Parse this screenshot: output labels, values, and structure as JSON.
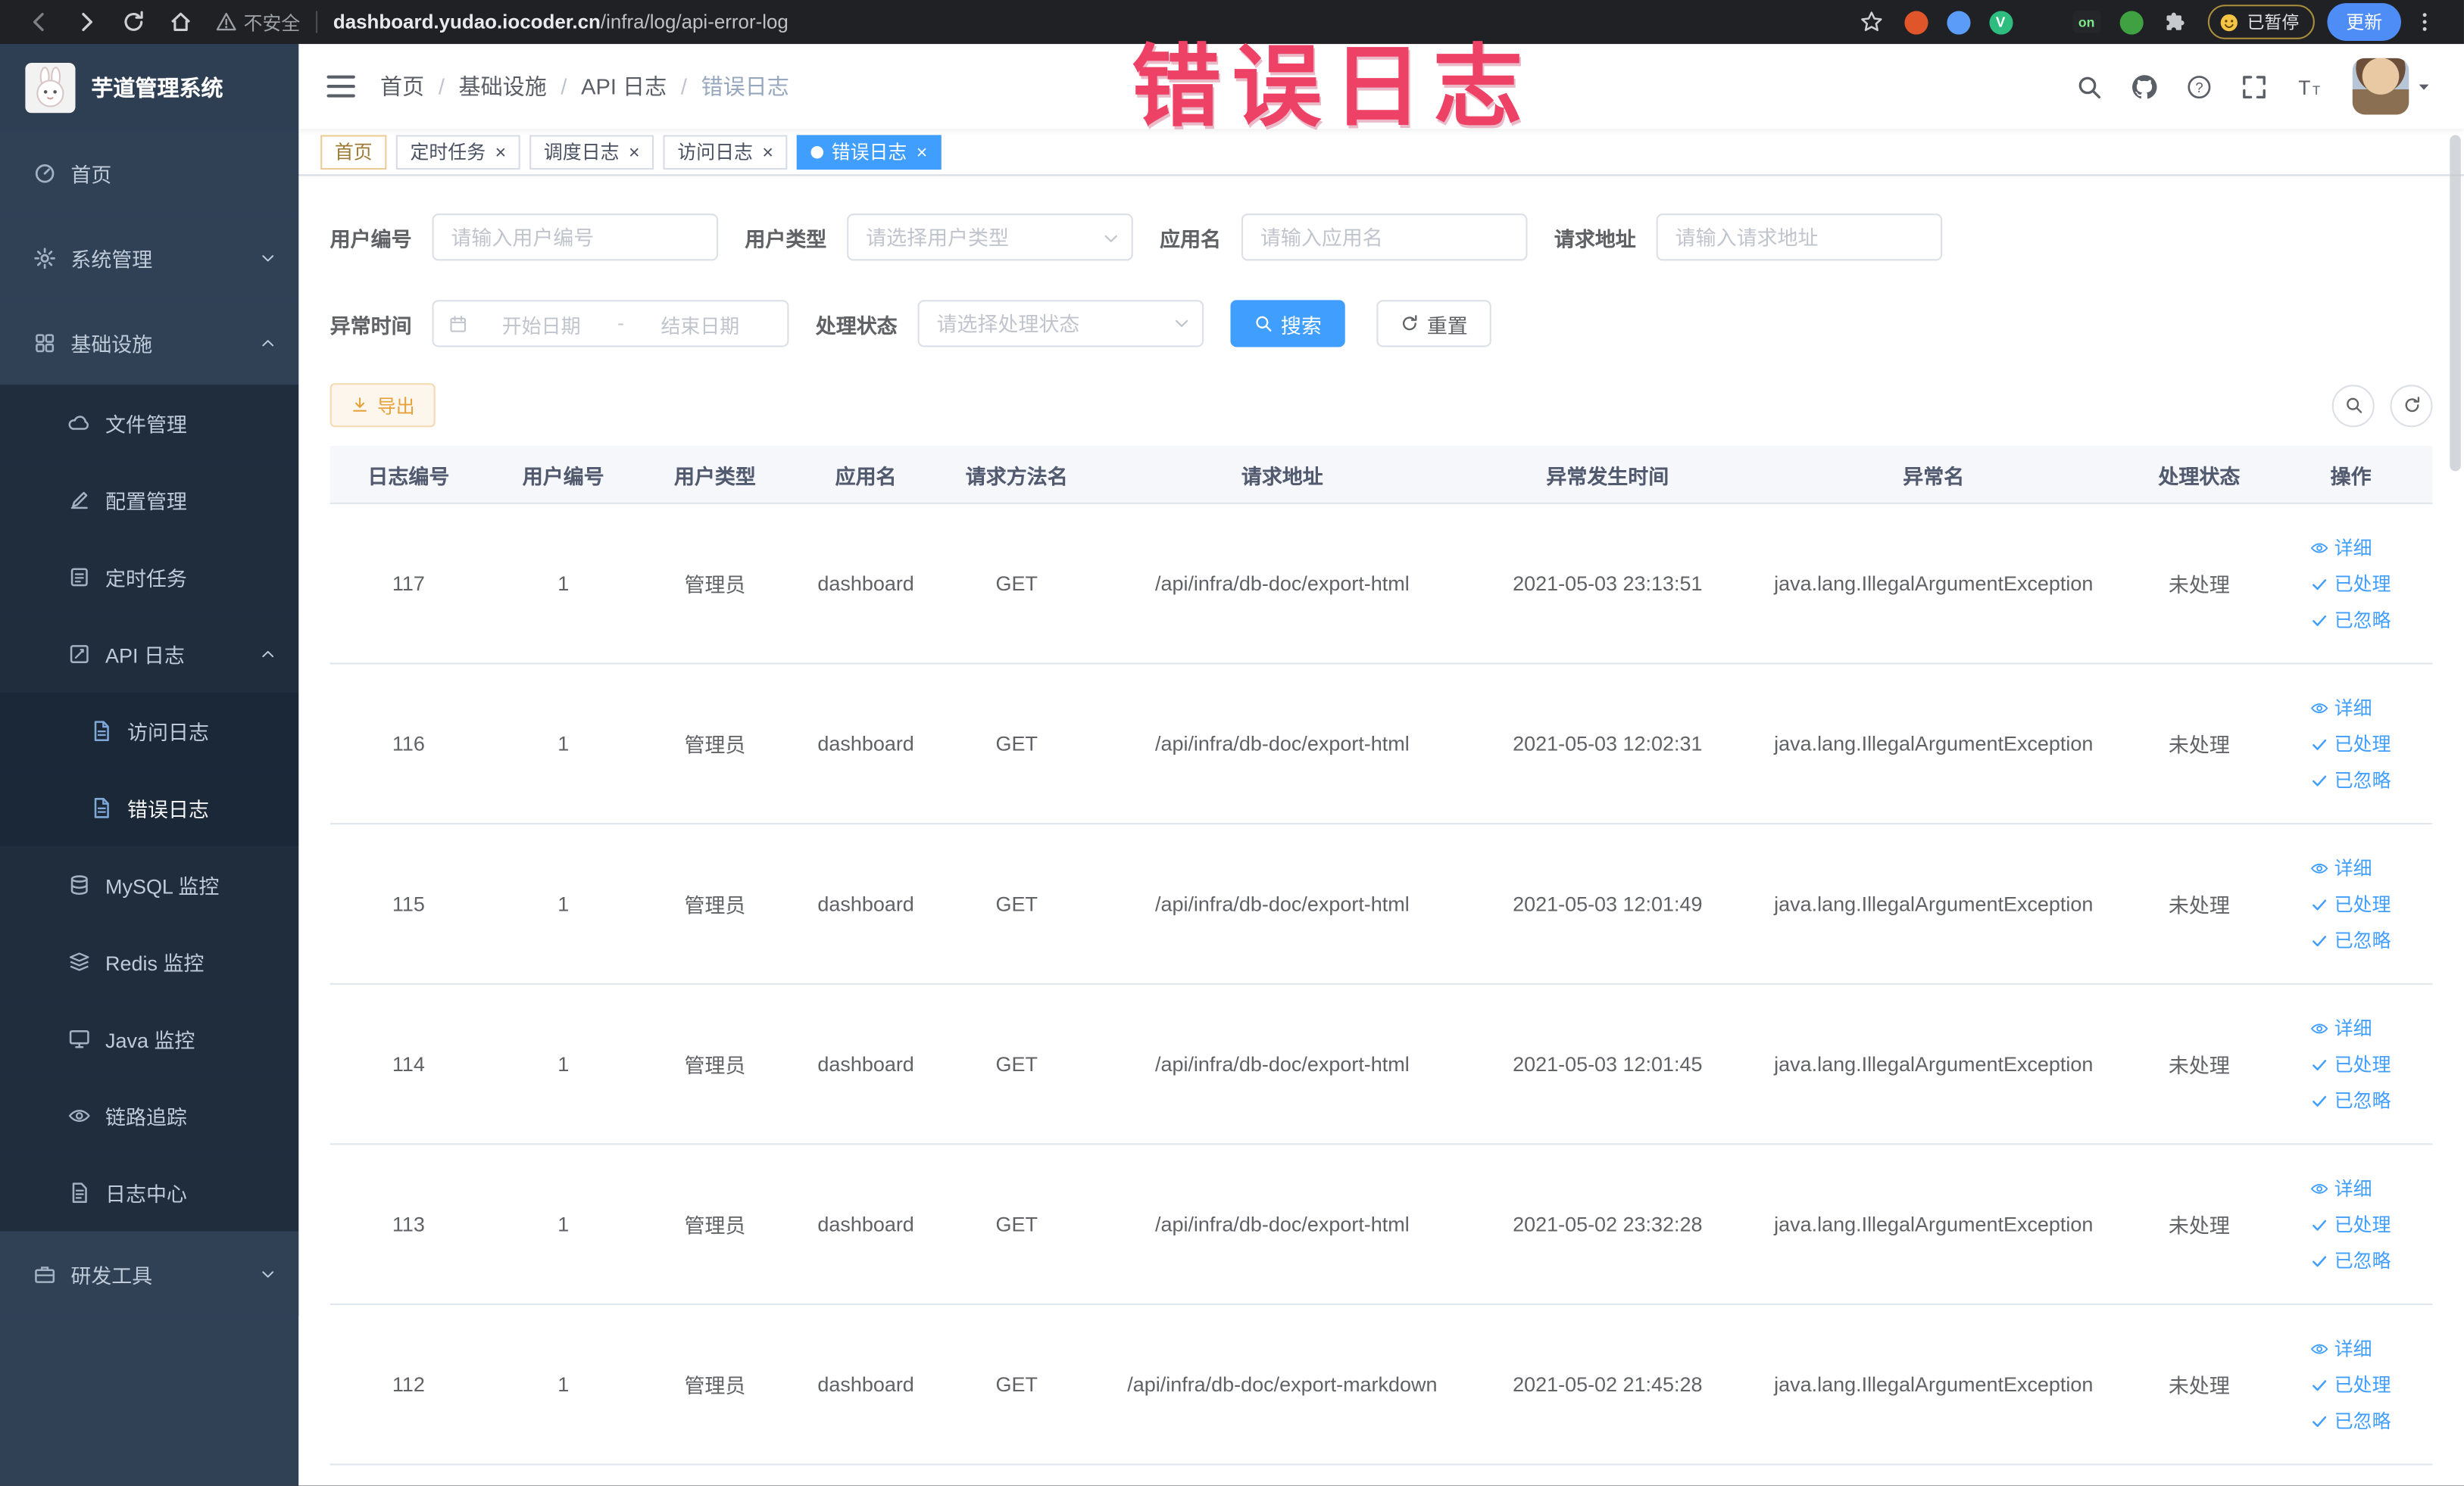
{
  "colors": {
    "accent": "#409eff",
    "warning": "#e6a23c",
    "annotation": "#ee4166",
    "sidebar_bg": "#304156",
    "sidebar_submenu_bg": "#1f2d3d"
  },
  "browser": {
    "security_label": "不安全",
    "url_domain": "dashboard.yudao.iocoder.cn",
    "url_path": "/infra/log/api-error-log",
    "extensions": [
      {
        "name": "adblock-extension-icon",
        "shape": "circle",
        "color": "#e0562a",
        "letter": ""
      },
      {
        "name": "blue-drop-extension-icon",
        "shape": "circle",
        "color": "#5b9cf8",
        "letter": ""
      },
      {
        "name": "vue-devtools-extension-icon",
        "shape": "circle",
        "color": "#2ebd7f",
        "letter": "V"
      },
      {
        "name": "grid-extension-icon",
        "shape": "grid",
        "color": "#4a7bd8",
        "letter": ""
      },
      {
        "name": "switch-badge-extension-icon",
        "shape": "badge",
        "color": "#24262a",
        "letter": "on",
        "letter_color": "#7ee787"
      },
      {
        "name": "leaf-extension-icon",
        "shape": "circle",
        "color": "#3fa142",
        "letter": ""
      },
      {
        "name": "puzzle-extensions-icon",
        "shape": "puzzle",
        "color": "#c6c9ce",
        "letter": ""
      }
    ],
    "paused_label": "已暂停",
    "update_label": "更新"
  },
  "sidebar": {
    "title": "芋道管理系统",
    "items": [
      {
        "label": "首页",
        "icon": "dashboard-icon",
        "level": 1
      },
      {
        "label": "系统管理",
        "icon": "gear-icon",
        "level": 1,
        "arrow": "down"
      },
      {
        "label": "基础设施",
        "icon": "infra-icon",
        "level": 1,
        "arrow": "up"
      },
      {
        "label": "文件管理",
        "icon": "cloud-icon",
        "level": 2
      },
      {
        "label": "配置管理",
        "icon": "edit-icon",
        "level": 2
      },
      {
        "label": "定时任务",
        "icon": "task-icon",
        "level": 2
      },
      {
        "label": "API 日志",
        "icon": "log-icon",
        "level": 2,
        "arrow": "up"
      },
      {
        "label": "访问日志",
        "icon": "doc-icon",
        "level": 3
      },
      {
        "label": "错误日志",
        "icon": "doc-icon",
        "level": 3,
        "active": true
      },
      {
        "label": "MySQL 监控",
        "icon": "db-icon",
        "level": 2
      },
      {
        "label": "Redis 监控",
        "icon": "redis-icon",
        "level": 2
      },
      {
        "label": "Java 监控",
        "icon": "java-icon",
        "level": 2
      },
      {
        "label": "链路追踪",
        "icon": "trace-icon",
        "level": 2
      },
      {
        "label": "日志中心",
        "icon": "logcenter-icon",
        "level": 2
      },
      {
        "label": "研发工具",
        "icon": "tool-icon",
        "level": 1,
        "arrow": "down"
      }
    ]
  },
  "navbar": {
    "breadcrumb": [
      "首页",
      "基础设施",
      "API 日志",
      "错误日志"
    ],
    "breadcrumb_separator": "/"
  },
  "annotation": {
    "text": "错误日志"
  },
  "tabs": [
    {
      "label": "首页",
      "affix": true,
      "closable": false,
      "active": false
    },
    {
      "label": "定时任务",
      "closable": true,
      "active": false
    },
    {
      "label": "调度日志",
      "closable": true,
      "active": false
    },
    {
      "label": "访问日志",
      "closable": true,
      "active": false
    },
    {
      "label": "错误日志",
      "closable": true,
      "active": true
    }
  ],
  "filters": {
    "fields": [
      {
        "label": "用户编号",
        "placeholder": "请输入用户编号",
        "type": "input",
        "name": "user-id"
      },
      {
        "label": "用户类型",
        "placeholder": "请选择用户类型",
        "type": "select",
        "name": "user-type"
      },
      {
        "label": "应用名",
        "placeholder": "请输入应用名",
        "type": "input",
        "name": "app-name"
      },
      {
        "label": "请求地址",
        "placeholder": "请输入请求地址",
        "type": "input",
        "name": "request-url"
      }
    ],
    "time_label": "异常时间",
    "time_start_placeholder": "开始日期",
    "time_separator": "-",
    "time_end_placeholder": "结束日期",
    "status_label": "处理状态",
    "status_placeholder": "请选择处理状态",
    "search_label": "搜索",
    "reset_label": "重置"
  },
  "toolbar": {
    "export_label": "导出"
  },
  "table": {
    "columns": [
      "日志编号",
      "用户编号",
      "用户类型",
      "应用名",
      "请求方法名",
      "请求地址",
      "异常发生时间",
      "异常名",
      "处理状态",
      "操作"
    ],
    "row_actions": [
      {
        "label": "详细",
        "icon": "eye-icon",
        "name": "detail-link"
      },
      {
        "label": "已处理",
        "icon": "check-icon",
        "name": "processed-link"
      },
      {
        "label": "已忽略",
        "icon": "check-icon",
        "name": "ignored-link"
      }
    ],
    "rows": [
      {
        "id": "117",
        "user_id": "1",
        "user_type": "管理员",
        "app_name": "dashboard",
        "method": "GET",
        "url": "/api/infra/db-doc/export-html",
        "time": "2021-05-03 23:13:51",
        "exception": "java.lang.IllegalArgumentException",
        "status": "未处理"
      },
      {
        "id": "116",
        "user_id": "1",
        "user_type": "管理员",
        "app_name": "dashboard",
        "method": "GET",
        "url": "/api/infra/db-doc/export-html",
        "time": "2021-05-03 12:02:31",
        "exception": "java.lang.IllegalArgumentException",
        "status": "未处理"
      },
      {
        "id": "115",
        "user_id": "1",
        "user_type": "管理员",
        "app_name": "dashboard",
        "method": "GET",
        "url": "/api/infra/db-doc/export-html",
        "time": "2021-05-03 12:01:49",
        "exception": "java.lang.IllegalArgumentException",
        "status": "未处理"
      },
      {
        "id": "114",
        "user_id": "1",
        "user_type": "管理员",
        "app_name": "dashboard",
        "method": "GET",
        "url": "/api/infra/db-doc/export-html",
        "time": "2021-05-03 12:01:45",
        "exception": "java.lang.IllegalArgumentException",
        "status": "未处理"
      },
      {
        "id": "113",
        "user_id": "1",
        "user_type": "管理员",
        "app_name": "dashboard",
        "method": "GET",
        "url": "/api/infra/db-doc/export-html",
        "time": "2021-05-02 23:32:28",
        "exception": "java.lang.IllegalArgumentException",
        "status": "未处理"
      },
      {
        "id": "112",
        "user_id": "1",
        "user_type": "管理员",
        "app_name": "dashboard",
        "method": "GET",
        "url": "/api/infra/db-doc/export-markdown",
        "time": "2021-05-02 21:45:28",
        "exception": "java.lang.IllegalArgumentException",
        "status": "未处理"
      }
    ]
  }
}
